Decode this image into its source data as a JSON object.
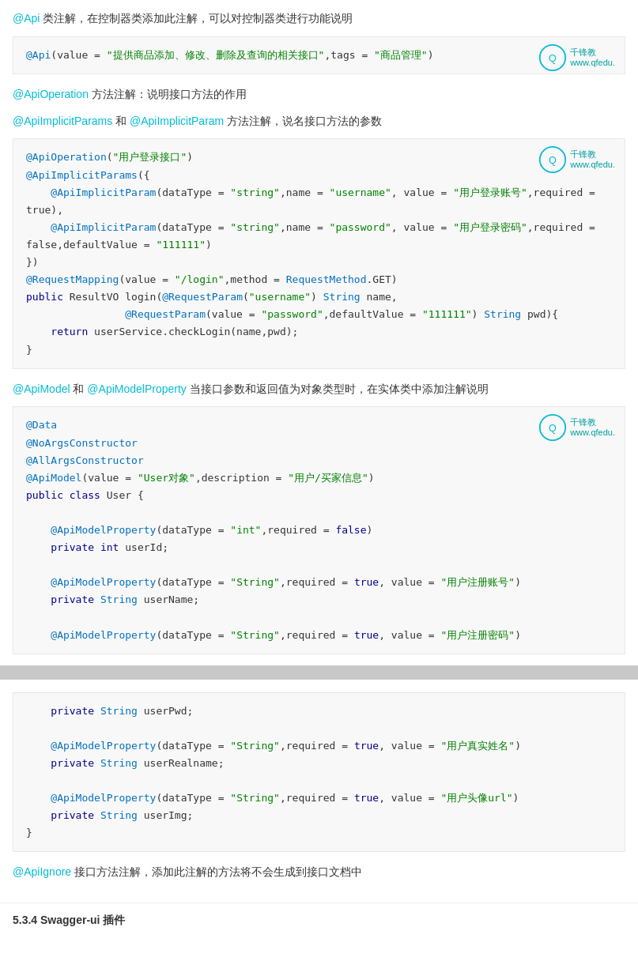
{
  "sections": {
    "api_heading": "@Api 类注解，在控制器类添加此注解，可以对控制器类进行功能说明",
    "api_code": "@Api(value = \"提供商品添加、修改、删除及查询的相关接口\",tags = \"商品管理\")",
    "api_operation_heading": "@ApiOperation 方法注解：说明接口方法的作用",
    "api_implicit_heading": "@ApiImplicitParams 和 @ApiImplicitParam 方法注解，说名接口方法的参数",
    "api_implicit_code_lines": [
      "@ApiOperation(\"用户登录接口\")",
      "@ApiImplicitParams({",
      "    @ApiImplicitParam(dataType = \"string\",name = \"username\", value = \"用户登录账号\",required =",
      "true),",
      "    @ApiImplicitParam(dataType = \"string\",name = \"password\", value = \"用户登录密码\",required =",
      "false,defaultValue = \"111111\")",
      "})",
      "@RequestMapping(value = \"/login\",method = RequestMethod.GET)",
      "public ResultVO login(@RequestParam(\"username\") String name,",
      "                @RequestParam(value = \"password\",defaultValue = \"111111\") String pwd){",
      "    return userService.checkLogin(name,pwd);",
      "}"
    ],
    "api_model_heading": "@ApiModel 和 @ApiModelProperty 当接口参数和返回值为对象类型时，在实体类中添加注解说明",
    "api_model_code_lines": [
      "@Data",
      "@NoArgsConstructor",
      "@AllArgsConstructor",
      "@ApiModel(value = \"User对象\",description = \"用户/买家信息\")",
      "public class User {",
      "",
      "    @ApiModelProperty(dataType = \"int\",required = false)",
      "    private int userId;",
      "",
      "    @ApiModelProperty(dataType = \"String\",required = true, value = \"用户注册账号\")",
      "    private String userName;",
      "",
      "    @ApiModelProperty(dataType = \"String\",required = true, value = \"用户注册密码\")"
    ],
    "bottom_code_lines": [
      "    private String userPwd;",
      "",
      "    @ApiModelProperty(dataType = \"String\",required = true, value = \"用户真实姓名\")",
      "    private String userRealname;",
      "",
      "    @ApiModelProperty(dataType = \"String\",required = true, value = \"用户头像url\")",
      "    private String userImg;",
      "}"
    ],
    "api_ignore_heading": "@ApiIgnore 接口方法注解，添加此注解的方法将不会生成到接口文档中",
    "footer_title": "5.3.4 Swagger-ui 插件"
  }
}
